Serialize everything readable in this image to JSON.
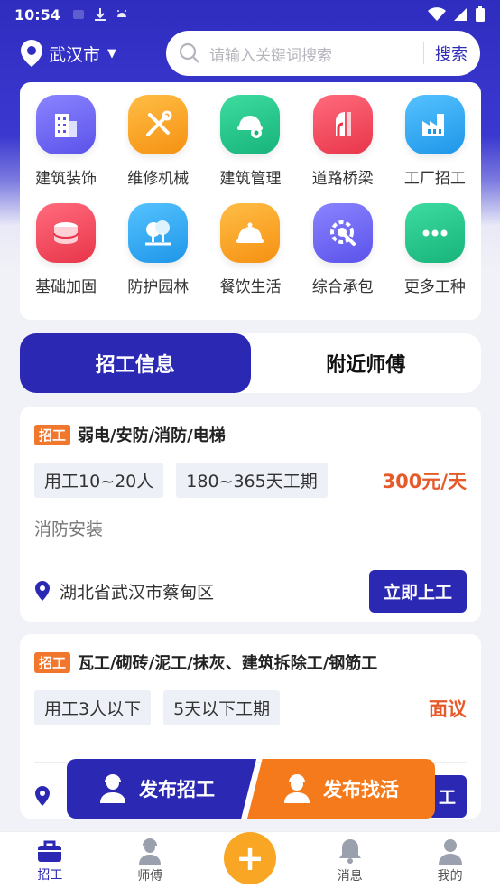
{
  "status_bar": {
    "time": "10:54"
  },
  "header": {
    "city": "武汉市",
    "search_placeholder": "请输入关键词搜索",
    "search_button": "搜索"
  },
  "categories": [
    {
      "label": "建筑装饰",
      "icon": "building-icon",
      "color": "#6a63f0"
    },
    {
      "label": "维修机械",
      "icon": "tools-icon",
      "color": "#f7a227"
    },
    {
      "label": "建筑管理",
      "icon": "helmet-gear-icon",
      "color": "#24c38a"
    },
    {
      "label": "道路桥梁",
      "icon": "road-bridge-icon",
      "color": "#ef4a5e"
    },
    {
      "label": "工厂招工",
      "icon": "factory-icon",
      "color": "#27a8ef"
    },
    {
      "label": "基础加固",
      "icon": "foundation-icon",
      "color": "#ef4a5e"
    },
    {
      "label": "防护园林",
      "icon": "tree-icon",
      "color": "#27a8ef"
    },
    {
      "label": "餐饮生活",
      "icon": "dish-cover-icon",
      "color": "#f7a227"
    },
    {
      "label": "综合承包",
      "icon": "search-gear-icon",
      "color": "#6a63f0"
    },
    {
      "label": "更多工种",
      "icon": "more-dots-icon",
      "color": "#24c38a"
    }
  ],
  "tabs": {
    "active": "招工信息",
    "other": "附近师傅"
  },
  "jobs": [
    {
      "badge": "招工",
      "title": "弱电/安防/消防/电梯",
      "tags": [
        "用工10~20人",
        "180~365天工期"
      ],
      "pay": "300元/天",
      "category": "消防安装",
      "location": "湖北省武汉市蔡甸区",
      "apply": "立即上工"
    },
    {
      "badge": "招工",
      "title": "瓦工/砌砖/泥工/抹灰、建筑拆除工/钢筋工",
      "tags": [
        "用工3人以下",
        "5天以下工期"
      ],
      "pay": "面议",
      "apply_partial": "工"
    }
  ],
  "post_buttons": {
    "hire": "发布招工",
    "find": "发布找活"
  },
  "bottom_nav": [
    {
      "label": "招工",
      "icon": "briefcase-icon"
    },
    {
      "label": "师傅",
      "icon": "worker-icon"
    },
    {
      "label": "消息",
      "icon": "bell-icon"
    },
    {
      "label": "我的",
      "icon": "user-icon"
    }
  ],
  "colors": {
    "primary": "#2b29b3",
    "accent": "#f57a1c",
    "pay": "#e65a2a",
    "plus": "#f8a623"
  }
}
